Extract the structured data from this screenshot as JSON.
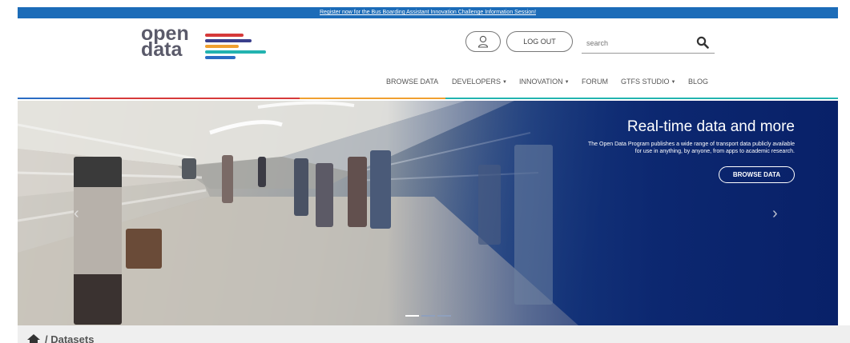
{
  "announcement": {
    "text": "Register now for the Bus Boarding Assistant Innovation Challenge Information Session!"
  },
  "logo": {
    "line1": "open",
    "line2": "data"
  },
  "header": {
    "logout_label": "LOG OUT",
    "search_placeholder": "search"
  },
  "nav": {
    "items": [
      {
        "label": "BROWSE DATA",
        "dropdown": false
      },
      {
        "label": "DEVELOPERS",
        "dropdown": true
      },
      {
        "label": "INNOVATION",
        "dropdown": true
      },
      {
        "label": "FORUM",
        "dropdown": false
      },
      {
        "label": "GTFS STUDIO",
        "dropdown": true
      },
      {
        "label": "BLOG",
        "dropdown": false
      }
    ]
  },
  "hero": {
    "title": "Real-time data and more",
    "description_line1": "The Open Data Program publishes a wide range of transport data publicly available",
    "description_line2": "for use in anything, by anyone, from apps to academic research.",
    "button_label": "BROWSE DATA",
    "slides_total": 3,
    "active_slide": 1
  },
  "breadcrumb": {
    "current": "/ Datasets"
  },
  "colors": {
    "announce_bg": "#1c6cb8",
    "brand_red": "#d63a3a",
    "brand_orange": "#f0a030",
    "brand_blue": "#2b6cc4",
    "brand_teal": "#22b3b0",
    "brand_navy": "#3a3f8c",
    "hero_dark": "#0f2f72"
  },
  "icons": {
    "user": "user-icon",
    "search": "search-icon",
    "home": "home-icon",
    "prev": "chevron-left-icon",
    "next": "chevron-right-icon"
  }
}
